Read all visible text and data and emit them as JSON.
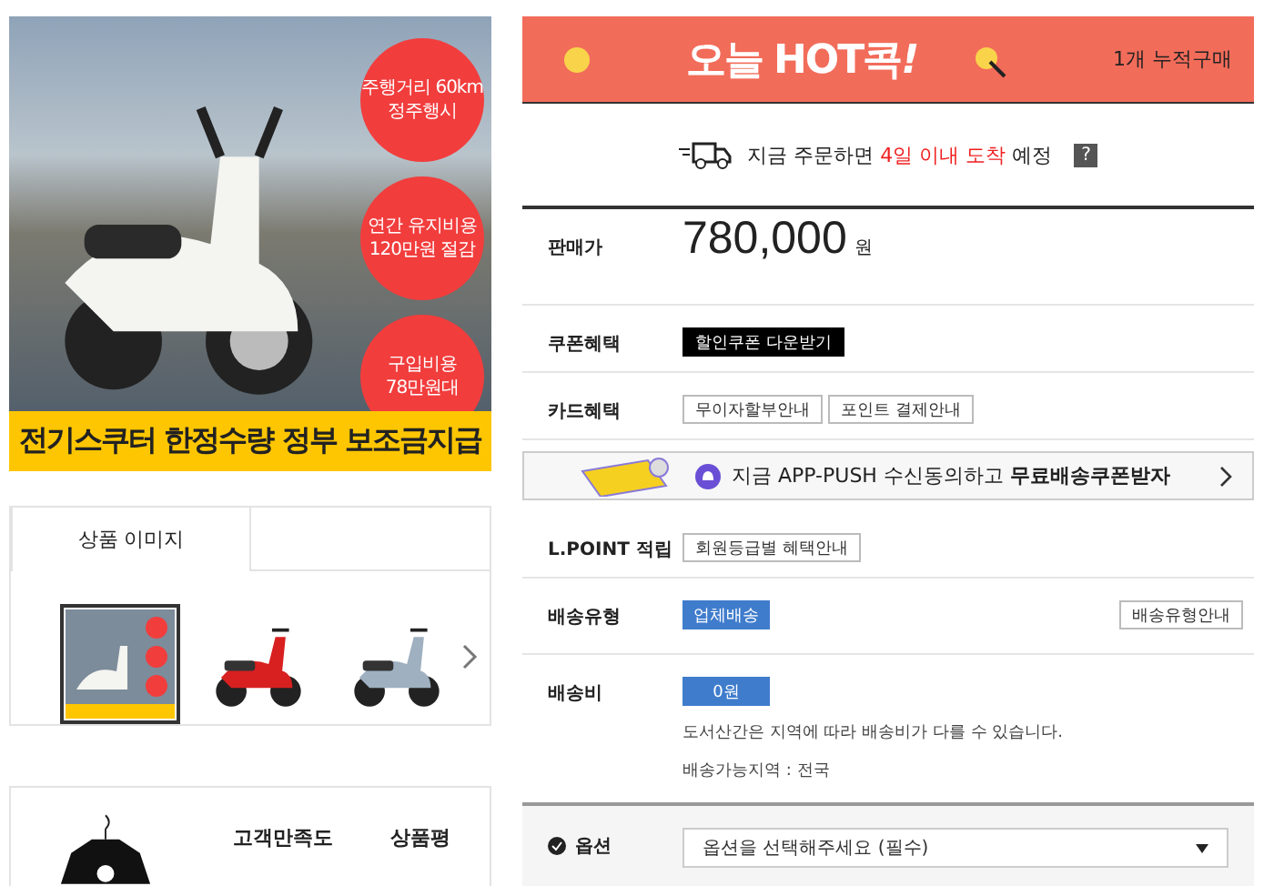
{
  "hero": {
    "badges": [
      "주행거리 60km\n정주행시",
      "연간 유지비용\n120만원 절감",
      "구입비용\n78만원대"
    ],
    "banner": "전기스쿠터 한정수량 정부 보조금지급"
  },
  "gallery": {
    "tabs": [
      {
        "label": "상품 이미지",
        "selected": true
      }
    ],
    "thumbnails": [
      {
        "selected": true,
        "kind": "poster"
      },
      {
        "selected": false,
        "kind": "red"
      },
      {
        "selected": false,
        "kind": "silver"
      }
    ]
  },
  "rating": {
    "labels": [
      "고객만족도",
      "상품평"
    ]
  },
  "promo": {
    "title": "오늘",
    "hot": "HOT",
    "suffix": "콕",
    "mark": "!",
    "count": "1개 누적구매"
  },
  "delivery": {
    "before": "지금 주문하면 ",
    "highlight": "4일 이내 도착",
    "after": " 예정",
    "help": "?"
  },
  "price": {
    "label": "판매가",
    "amount": "780,000",
    "unit": "원"
  },
  "rows": [
    {
      "kind": "buttons",
      "label": "쿠폰혜택",
      "buttons": [
        {
          "text": "할인쿠폰 다운받기",
          "dark": true
        }
      ]
    },
    {
      "kind": "buttons",
      "label": "카드혜택",
      "buttons": [
        {
          "text": "무이자할부안내",
          "dark": false
        },
        {
          "text": "포인트 결제안내",
          "dark": false
        }
      ]
    },
    {
      "kind": "push",
      "text": "지금 APP-PUSH 수신동의하고 **무료배송쿠폰받자**"
    },
    {
      "kind": "buttons",
      "label": "L.POINT 적립",
      "buttons": [
        {
          "text": "회원등급별 혜택안내",
          "dark": false
        }
      ]
    },
    {
      "kind": "shipping",
      "label": "배송유형",
      "tag": "업체배송",
      "button": "배송유형안내"
    },
    {
      "kind": "fee",
      "label": "배송비",
      "tag": "0원",
      "notes": [
        "도서산간은 지역에 따라 배송비가 다를 수 있습니다.",
        "배송가능지역 : 전국"
      ]
    }
  ],
  "option": {
    "label": "옵션",
    "placeholder": "옵션을 선택해주세요 (필수)"
  }
}
